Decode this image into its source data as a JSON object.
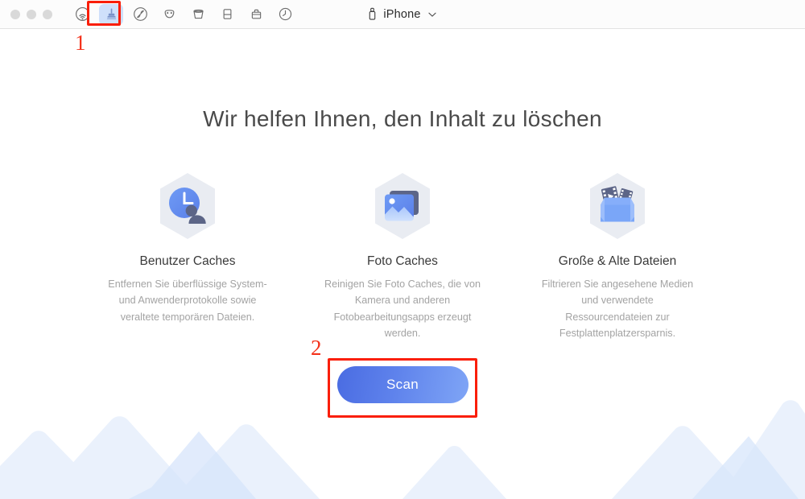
{
  "window": {
    "traffic_lights": [
      "close",
      "minimize",
      "zoom"
    ],
    "device_label": "iPhone"
  },
  "toolbar": {
    "items": [
      {
        "name": "airdrop-icon",
        "label": "AirDrop",
        "active": false
      },
      {
        "name": "broom-icon",
        "label": "Clean",
        "active": true
      },
      {
        "name": "globe-slash-icon",
        "label": "Browser",
        "active": false
      },
      {
        "name": "mask-icon",
        "label": "Privacy",
        "active": false
      },
      {
        "name": "bucket-icon",
        "label": "Bucket",
        "active": false
      },
      {
        "name": "device-icon",
        "label": "Device",
        "active": false
      },
      {
        "name": "toolbox-icon",
        "label": "Toolbox",
        "active": false
      },
      {
        "name": "clock-icon",
        "label": "History",
        "active": false
      }
    ]
  },
  "annotations": [
    {
      "id": "1",
      "text": "1"
    },
    {
      "id": "2",
      "text": "2"
    }
  ],
  "main": {
    "headline": "Wir helfen Ihnen, den Inhalt zu löschen",
    "cards": [
      {
        "icon": "user-caches-icon",
        "title": "Benutzer Caches",
        "desc": "Entfernen Sie überflüssige System- und Anwenderprotokolle sowie veraltete temporären Dateien."
      },
      {
        "icon": "photo-caches-icon",
        "title": "Foto Caches",
        "desc": "Reinigen Sie Foto Caches, die von Kamera und anderen Fotobearbeitungsapps erzeugt werden."
      },
      {
        "icon": "large-old-files-icon",
        "title": "Große & Alte Dateien",
        "desc": "Filtrieren Sie angesehene Medien und verwendete Ressourcendateien zur Festplattenplatzersparnis."
      }
    ],
    "scan_button": "Scan"
  },
  "colors": {
    "accent": "#5f83ec",
    "accent_dark": "#4a6ce2",
    "accent_light": "#7fa5f6",
    "annotation_red": "#f4331c",
    "highlight_red": "#fa1e08",
    "toolbar_active_bg": "#cfe0fb",
    "mountain_light": "#eaf1fc",
    "mountain_mid": "#dfeafb",
    "heading_text": "#4a4a4a",
    "body_text": "#a3a3a3"
  }
}
